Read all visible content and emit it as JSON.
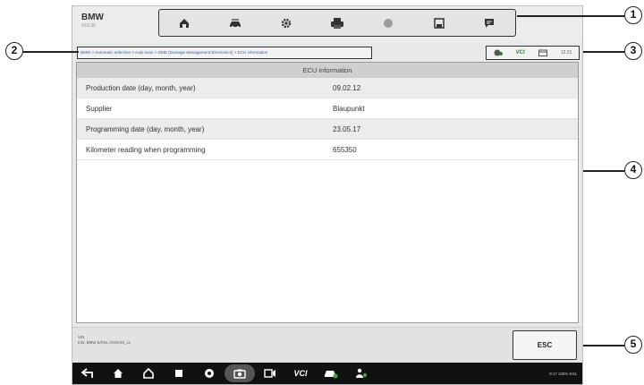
{
  "brand": {
    "name": "BMW",
    "version": "V10.30"
  },
  "toolbar": {
    "icons": [
      "home-icon",
      "car-swap-icon",
      "gear-icon",
      "printer-icon",
      "record-icon",
      "save-icon",
      "message-icon"
    ]
  },
  "breadcrumb": "BMW > Automatic selection > Auto scan > DME (Damage Management Electronics) > ECU information",
  "status": {
    "vci": "VCI",
    "time": "12:21"
  },
  "panel": {
    "title": "ECU information",
    "rows": [
      {
        "label": "Production date (day, month, year)",
        "value": "09.02.12"
      },
      {
        "label": "Supplier",
        "value": "Blaupunkt"
      },
      {
        "label": "Programming date (day, month, year)",
        "value": "23.05.17"
      },
      {
        "label": "Kilometer reading when programming",
        "value": "655350"
      }
    ]
  },
  "footer": {
    "vin_label": "VIN",
    "vin_info": "Info: BMW E/XXL /XXX/XX_LL",
    "esc_label": "ESC"
  },
  "navbar": {
    "vci": "VCI",
    "status": "9:17  100%  8:51"
  },
  "callouts": [
    "1",
    "2",
    "3",
    "4",
    "5"
  ]
}
